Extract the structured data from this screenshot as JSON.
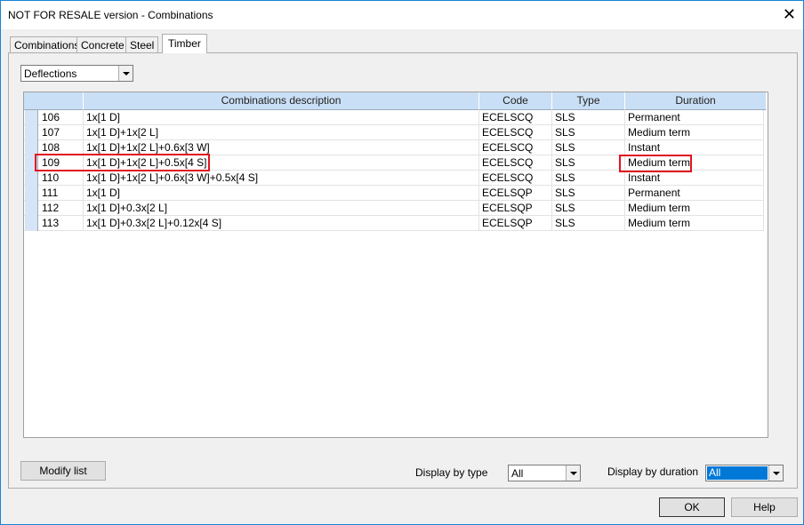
{
  "window": {
    "title": "NOT FOR RESALE version - Combinations",
    "close_icon": "close-icon"
  },
  "tabs": [
    {
      "label": "Combinations"
    },
    {
      "label": "Concrete"
    },
    {
      "label": "Steel"
    },
    {
      "label": "Timber",
      "active": true
    }
  ],
  "filter": {
    "value": "Deflections"
  },
  "table": {
    "headers": [
      "",
      "Combinations description",
      "Code",
      "Type",
      "Duration"
    ],
    "rows": [
      {
        "id": "106",
        "desc": "1x[1 D]",
        "code": "ECELSCQ",
        "type": "SLS",
        "duration": "Permanent"
      },
      {
        "id": "107",
        "desc": "1x[1 D]+1x[2 L]",
        "code": "ECELSCQ",
        "type": "SLS",
        "duration": "Medium term"
      },
      {
        "id": "108",
        "desc": "1x[1 D]+1x[2 L]+0.6x[3 W]",
        "code": "ECELSCQ",
        "type": "SLS",
        "duration": "Instant"
      },
      {
        "id": "109",
        "desc": "1x[1 D]+1x[2 L]+0.5x[4 S]",
        "code": "ECELSCQ",
        "type": "SLS",
        "duration": "Medium term",
        "highlighted": true
      },
      {
        "id": "110",
        "desc": "1x[1 D]+1x[2 L]+0.6x[3 W]+0.5x[4 S]",
        "code": "ECELSCQ",
        "type": "SLS",
        "duration": "Instant"
      },
      {
        "id": "111",
        "desc": "1x[1 D]",
        "code": "ECELSQP",
        "type": "SLS",
        "duration": "Permanent"
      },
      {
        "id": "112",
        "desc": "1x[1 D]+0.3x[2 L]",
        "code": "ECELSQP",
        "type": "SLS",
        "duration": "Medium term"
      },
      {
        "id": "113",
        "desc": "1x[1 D]+0.3x[2 L]+0.12x[4 S]",
        "code": "ECELSQP",
        "type": "SLS",
        "duration": "Medium term"
      }
    ]
  },
  "bottom": {
    "modify_label": "Modify list",
    "type_label": "Display by type",
    "type_value": "All",
    "duration_label": "Display by duration",
    "duration_value": "All"
  },
  "buttons": {
    "ok": "OK",
    "help": "Help"
  },
  "colors": {
    "highlight": "#e0141e",
    "selection": "#0078d7",
    "header": "#c9dff5"
  }
}
